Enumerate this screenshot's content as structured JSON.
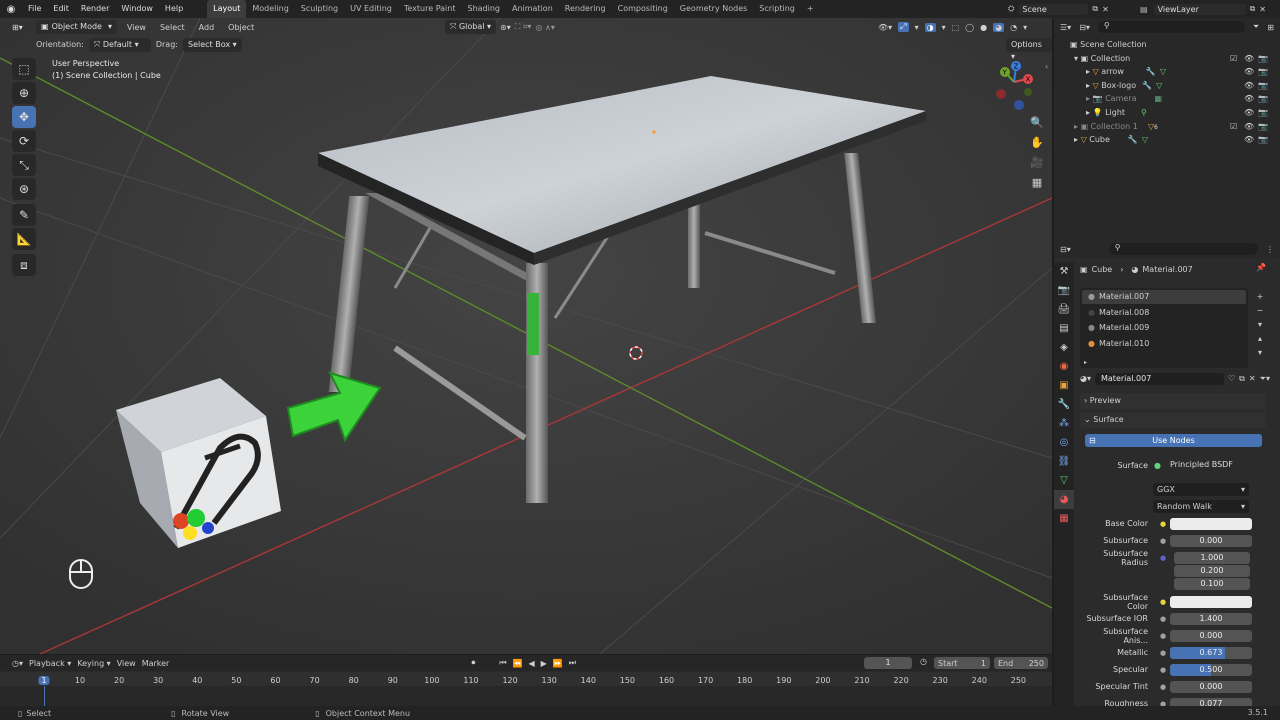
{
  "topbar": {
    "menus": [
      "File",
      "Edit",
      "Render",
      "Window",
      "Help"
    ],
    "workspaces": [
      "Layout",
      "Modeling",
      "Sculpting",
      "UV Editing",
      "Texture Paint",
      "Shading",
      "Animation",
      "Rendering",
      "Compositing",
      "Geometry Nodes",
      "Scripting"
    ],
    "add_tab": "+",
    "scene": "Scene",
    "view_layer": "ViewLayer"
  },
  "viewport": {
    "mode": "Object Mode",
    "menus": [
      "View",
      "Select",
      "Add",
      "Object"
    ],
    "orientation_label": "Orientation:",
    "orientation_value": "Default",
    "drag_label": "Drag:",
    "drag_value": "Select Box",
    "transform_orientation": "Global",
    "options": "Options",
    "perspective": "User Perspective",
    "collection_info": "(1) Scene Collection | Cube"
  },
  "outliner": {
    "root": "Scene Collection",
    "items": [
      {
        "label": "Collection",
        "indent": 1
      },
      {
        "label": "arrow",
        "indent": 2
      },
      {
        "label": "Box-logo",
        "indent": 2
      },
      {
        "label": "Camera",
        "indent": 2
      },
      {
        "label": "Light",
        "indent": 2
      },
      {
        "label": "Collection 1",
        "indent": 1
      },
      {
        "label": "Cube",
        "indent": 1
      }
    ],
    "collection1_badge": "6"
  },
  "properties": {
    "breadcrumb_object": "Cube",
    "breadcrumb_material": "Material.007",
    "material_slots": [
      "Material.007",
      "Material.008",
      "Material.009",
      "Material.010"
    ],
    "material_name": "Material.007",
    "preview": "Preview",
    "surface_panel": "Surface",
    "use_nodes": "Use Nodes",
    "surface_label": "Surface",
    "surface_value": "Principled BSDF",
    "distribution": "GGX",
    "subsurface_method": "Random Walk",
    "rows": [
      {
        "label": "Base Color",
        "type": "color",
        "color": "#ececec"
      },
      {
        "label": "Subsurface",
        "type": "num",
        "value": "0.000"
      },
      {
        "label": "Subsurface Radius",
        "type": "num",
        "value": "1.000"
      },
      {
        "label": "",
        "type": "num",
        "value": "0.200"
      },
      {
        "label": "",
        "type": "num",
        "value": "0.100"
      },
      {
        "label": "Subsurface Color",
        "type": "color",
        "color": "#ececec"
      },
      {
        "label": "Subsurface IOR",
        "type": "num",
        "value": "1.400"
      },
      {
        "label": "Subsurface Anis...",
        "type": "num",
        "value": "0.000"
      },
      {
        "label": "Metallic",
        "type": "num",
        "value": "0.673",
        "fill": 0.673
      },
      {
        "label": "Specular",
        "type": "num",
        "value": "0.500",
        "fill": 0.5
      },
      {
        "label": "Specular Tint",
        "type": "num",
        "value": "0.000"
      },
      {
        "label": "Roughness",
        "type": "num",
        "value": "0.077"
      }
    ]
  },
  "timeline": {
    "menus": [
      "Playback",
      "Keying",
      "View",
      "Marker"
    ],
    "current_frame": "1",
    "start_label": "Start",
    "start": "1",
    "end_label": "End",
    "end": "250",
    "ticks": [
      "1",
      "10",
      "20",
      "30",
      "40",
      "50",
      "60",
      "70",
      "80",
      "90",
      "100",
      "110",
      "120",
      "130",
      "140",
      "150",
      "160",
      "170",
      "180",
      "190",
      "200",
      "210",
      "220",
      "230",
      "240",
      "250"
    ]
  },
  "statusbar": {
    "select": "Select",
    "rotate": "Rotate View",
    "context": "Object Context Menu",
    "version": "3.5.1"
  },
  "colors": {
    "accent": "#4772b3",
    "gizmo_x": "#e0484e",
    "gizmo_y": "#6da32f",
    "gizmo_z": "#3a7fe0"
  }
}
